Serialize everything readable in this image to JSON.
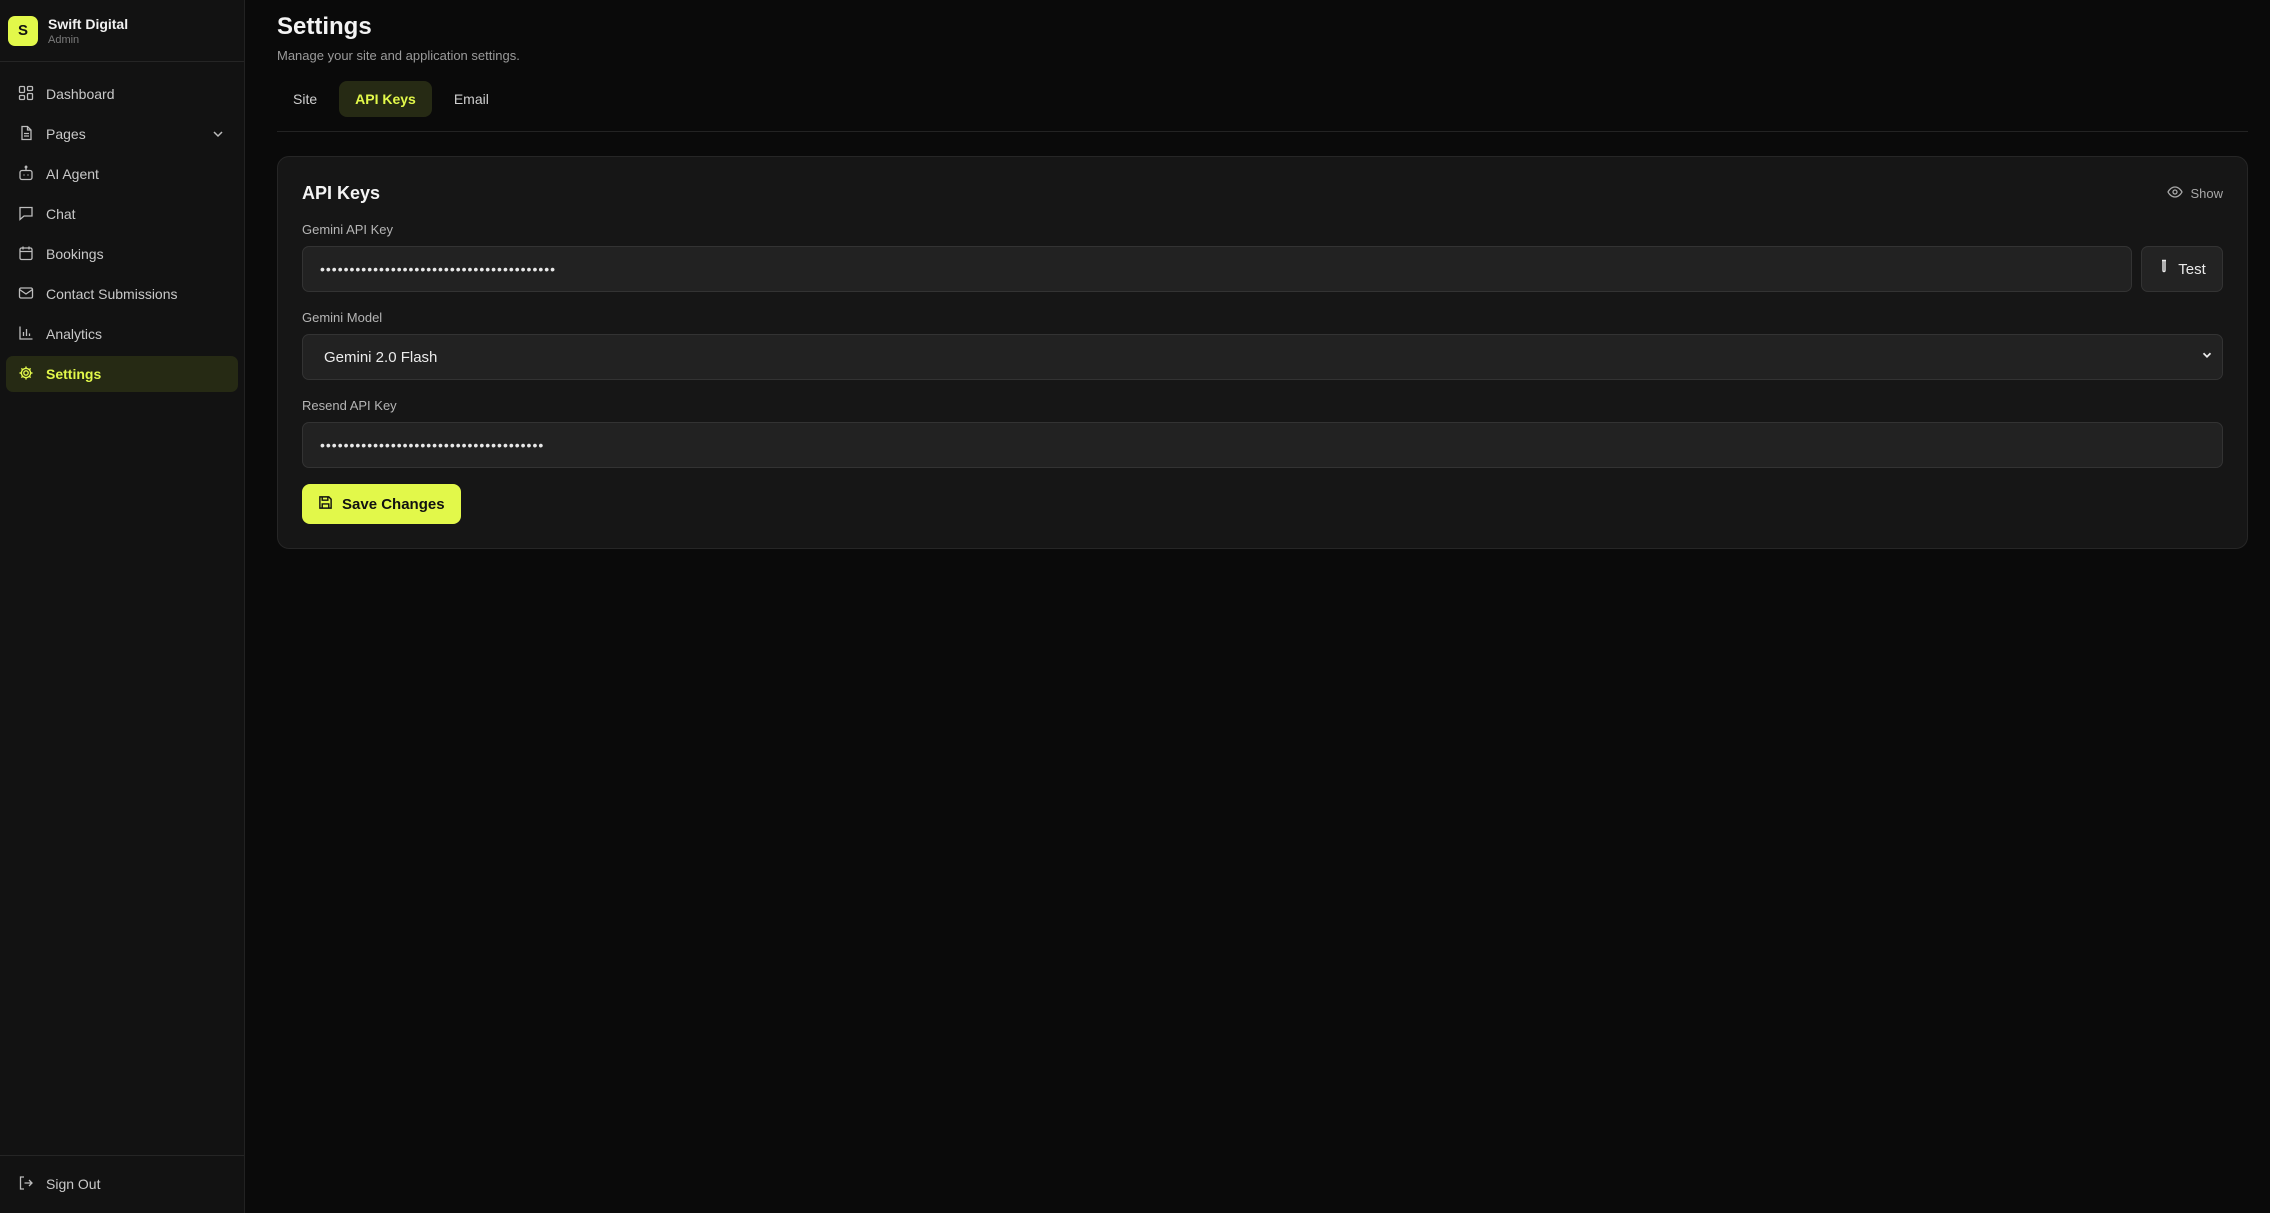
{
  "brand": {
    "initial": "S",
    "name": "Swift Digital",
    "role": "Admin"
  },
  "sidebar": {
    "items": [
      {
        "label": "Dashboard",
        "icon": "dashboard-grid-icon"
      },
      {
        "label": "Pages",
        "icon": "file-icon",
        "expandable": true
      },
      {
        "label": "AI Agent",
        "icon": "bot-icon"
      },
      {
        "label": "Chat",
        "icon": "chat-bubble-icon"
      },
      {
        "label": "Bookings",
        "icon": "calendar-icon"
      },
      {
        "label": "Contact Submissions",
        "icon": "mail-icon"
      },
      {
        "label": "Analytics",
        "icon": "bar-chart-icon"
      },
      {
        "label": "Settings",
        "icon": "gear-icon",
        "active": true
      }
    ],
    "sign_out": "Sign Out"
  },
  "header": {
    "title": "Settings",
    "subtitle": "Manage your site and application settings."
  },
  "tabs": [
    {
      "label": "Site"
    },
    {
      "label": "API Keys",
      "active": true
    },
    {
      "label": "Email"
    }
  ],
  "card": {
    "title": "API Keys",
    "show_label": "Show",
    "gemini_key": {
      "label": "Gemini API Key",
      "value": "••••••••••••••••••••••••••••••••••••••••",
      "test_label": "Test"
    },
    "gemini_model": {
      "label": "Gemini Model",
      "selected": "Gemini 2.0 Flash"
    },
    "resend_key": {
      "label": "Resend API Key",
      "value": "••••••••••••••••••••••••••••••••••••••"
    },
    "save_label": "Save Changes"
  },
  "colors": {
    "accent": "#e2f84a",
    "background": "#0a0a0a",
    "sidebar": "#121212",
    "card": "#161616"
  }
}
